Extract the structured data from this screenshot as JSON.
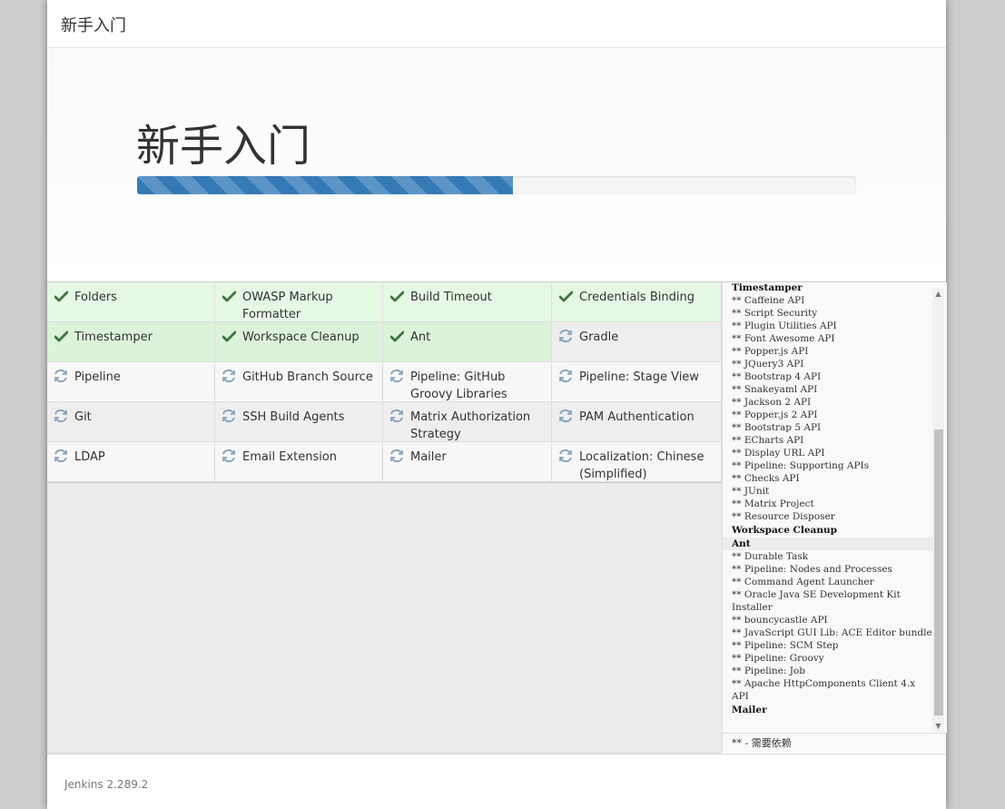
{
  "header": {
    "title": "新手入门"
  },
  "hero": {
    "title": "新手入门",
    "progress": 0.523
  },
  "plugins": [
    {
      "name": "Folders",
      "status": "success"
    },
    {
      "name": "OWASP Markup Formatter",
      "status": "success"
    },
    {
      "name": "Build Timeout",
      "status": "success"
    },
    {
      "name": "Credentials Binding",
      "status": "success"
    },
    {
      "name": "Timestamper",
      "status": "success"
    },
    {
      "name": "Workspace Cleanup",
      "status": "success"
    },
    {
      "name": "Ant",
      "status": "success"
    },
    {
      "name": "Gradle",
      "status": "pending"
    },
    {
      "name": "Pipeline",
      "status": "pending"
    },
    {
      "name": "GitHub Branch Source",
      "status": "pending"
    },
    {
      "name": "Pipeline: GitHub Groovy Libraries",
      "status": "pending"
    },
    {
      "name": "Pipeline: Stage View",
      "status": "pending"
    },
    {
      "name": "Git",
      "status": "pending"
    },
    {
      "name": "SSH Build Agents",
      "status": "pending"
    },
    {
      "name": "Matrix Authorization Strategy",
      "status": "pending"
    },
    {
      "name": "PAM Authentication",
      "status": "pending"
    },
    {
      "name": "LDAP",
      "status": "pending"
    },
    {
      "name": "Email Extension",
      "status": "pending"
    },
    {
      "name": "Mailer",
      "status": "pending"
    },
    {
      "name": "Localization: Chinese (Simplified)",
      "status": "pending"
    }
  ],
  "log": [
    {
      "text": "Timestamper",
      "type": "main"
    },
    {
      "text": "** Caffeine API",
      "type": "dep"
    },
    {
      "text": "** Script Security",
      "type": "dep"
    },
    {
      "text": "** Plugin Utilities API",
      "type": "dep"
    },
    {
      "text": "** Font Awesome API",
      "type": "dep"
    },
    {
      "text": "** Popper.js API",
      "type": "dep"
    },
    {
      "text": "** JQuery3 API",
      "type": "dep"
    },
    {
      "text": "** Bootstrap 4 API",
      "type": "dep"
    },
    {
      "text": "** Snakeyaml API",
      "type": "dep"
    },
    {
      "text": "** Jackson 2 API",
      "type": "dep"
    },
    {
      "text": "** Popper.js 2 API",
      "type": "dep"
    },
    {
      "text": "** Bootstrap 5 API",
      "type": "dep"
    },
    {
      "text": "** ECharts API",
      "type": "dep"
    },
    {
      "text": "** Display URL API",
      "type": "dep"
    },
    {
      "text": "** Pipeline: Supporting APIs",
      "type": "dep"
    },
    {
      "text": "** Checks API",
      "type": "dep"
    },
    {
      "text": "** JUnit",
      "type": "dep"
    },
    {
      "text": "** Matrix Project",
      "type": "dep"
    },
    {
      "text": "** Resource Disposer",
      "type": "dep"
    },
    {
      "text": "Workspace Cleanup",
      "type": "main"
    },
    {
      "text": "Ant",
      "type": "main-hl"
    },
    {
      "text": "** Durable Task",
      "type": "dep"
    },
    {
      "text": "** Pipeline: Nodes and Processes",
      "type": "dep"
    },
    {
      "text": "** Command Agent Launcher",
      "type": "dep"
    },
    {
      "text": "** Oracle Java SE Development Kit Installer",
      "type": "dep"
    },
    {
      "text": "** bouncycastle API",
      "type": "dep"
    },
    {
      "text": "** JavaScript GUI Lib: ACE Editor bundle",
      "type": "dep"
    },
    {
      "text": "** Pipeline: SCM Step",
      "type": "dep"
    },
    {
      "text": "** Pipeline: Groovy",
      "type": "dep"
    },
    {
      "text": "** Pipeline: Job",
      "type": "dep"
    },
    {
      "text": "** Apache HttpComponents Client 4.x API",
      "type": "dep"
    },
    {
      "text": "Mailer",
      "type": "main"
    }
  ],
  "legend": "** - 需要依赖",
  "footer": {
    "version": "Jenkins 2.289.2"
  },
  "colors": {
    "success_icon": "#3c763d",
    "pending_icon": "#8aa5bc",
    "progress": "#337ab7"
  },
  "icons": {
    "success": "check-icon",
    "pending": "refresh-icon"
  }
}
